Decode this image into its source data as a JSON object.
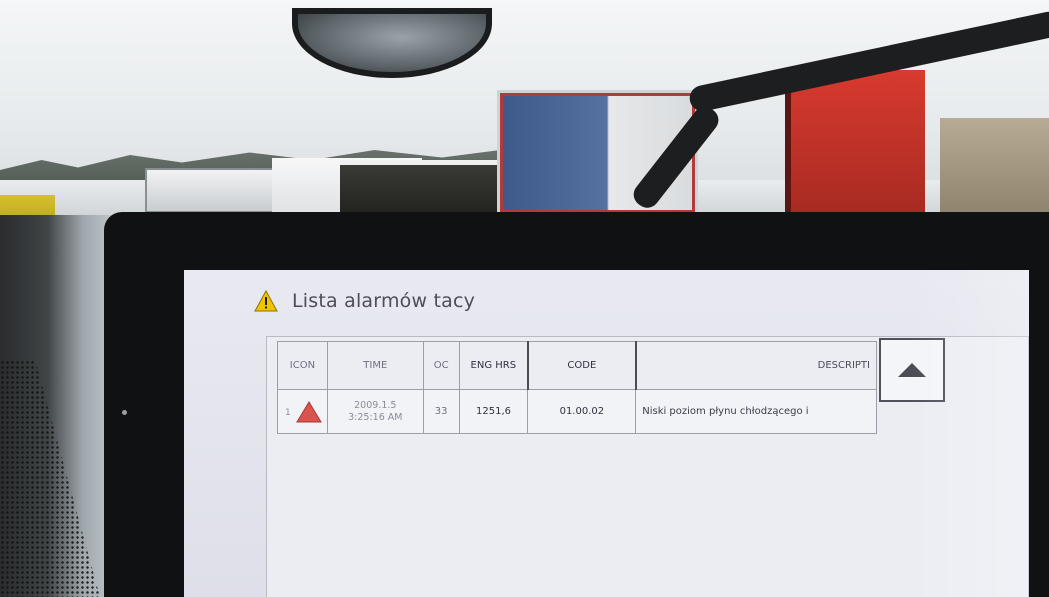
{
  "window": {
    "title": "Lista alarmów tacy",
    "title_icon": "warning-triangle-icon"
  },
  "table": {
    "columns": [
      "ICON",
      "TIME",
      "OC",
      "ENG HRS",
      "CODE",
      "DESCRIPTI"
    ],
    "rows": [
      {
        "index": "1",
        "icon": "alarm-triangle-icon",
        "time_line1": "2009.1.5",
        "time_line2": "3:25:16 AM",
        "oc": "33",
        "eng_hrs": "1251,6",
        "code": "01.00.02",
        "description": "Niski poziom płynu chłodzącego i"
      }
    ]
  },
  "controls": {
    "scroll_up_icon": "up-arrow-icon"
  },
  "colors": {
    "alarm_red": "#d9534f",
    "warning_yellow": "#f2c400",
    "screen_bg": "#e4e5ee"
  }
}
